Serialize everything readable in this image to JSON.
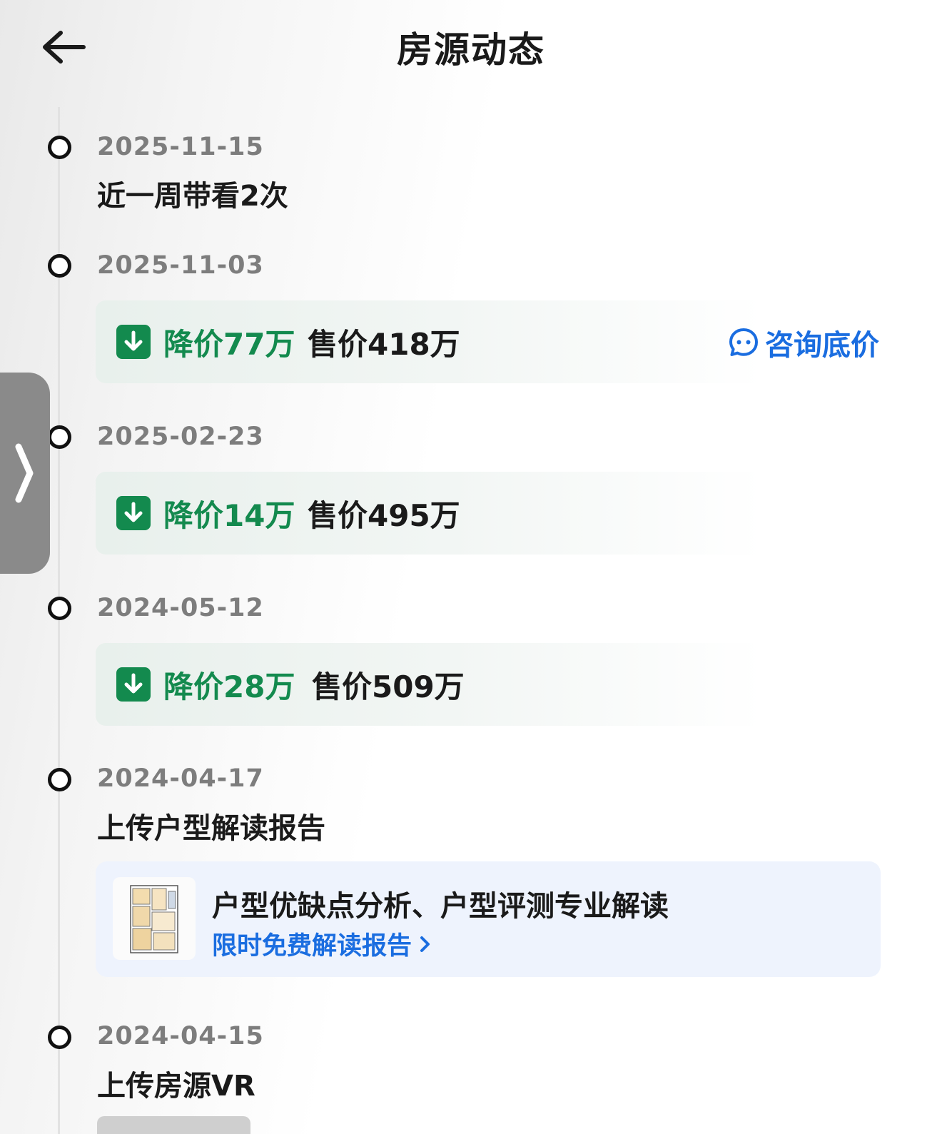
{
  "header": {
    "title": "房源动态",
    "back_icon": "arrow-left-icon"
  },
  "timeline": [
    {
      "date": "2025-11-15",
      "text": "近一周带看2次"
    },
    {
      "date": "2025-11-03",
      "drop": "降价77万",
      "price": "售价418万",
      "action": "咨询底价"
    },
    {
      "date": "2025-02-23",
      "drop": "降价14万",
      "price": "售价495万"
    },
    {
      "date": "2024-05-12",
      "drop": "降价28万",
      "price": "售价509万"
    },
    {
      "date": "2024-04-17",
      "text": "上传户型解读报告",
      "report": {
        "title": "户型优缺点分析、户型评测专业解读",
        "link": "限时免费解读报告"
      }
    },
    {
      "date": "2024-04-15",
      "text": "上传房源VR"
    }
  ],
  "colors": {
    "accent_green": "#138a4e",
    "accent_blue": "#1a6de0",
    "text_dark": "#1a1a1a",
    "text_gray": "#7d7d7d"
  }
}
